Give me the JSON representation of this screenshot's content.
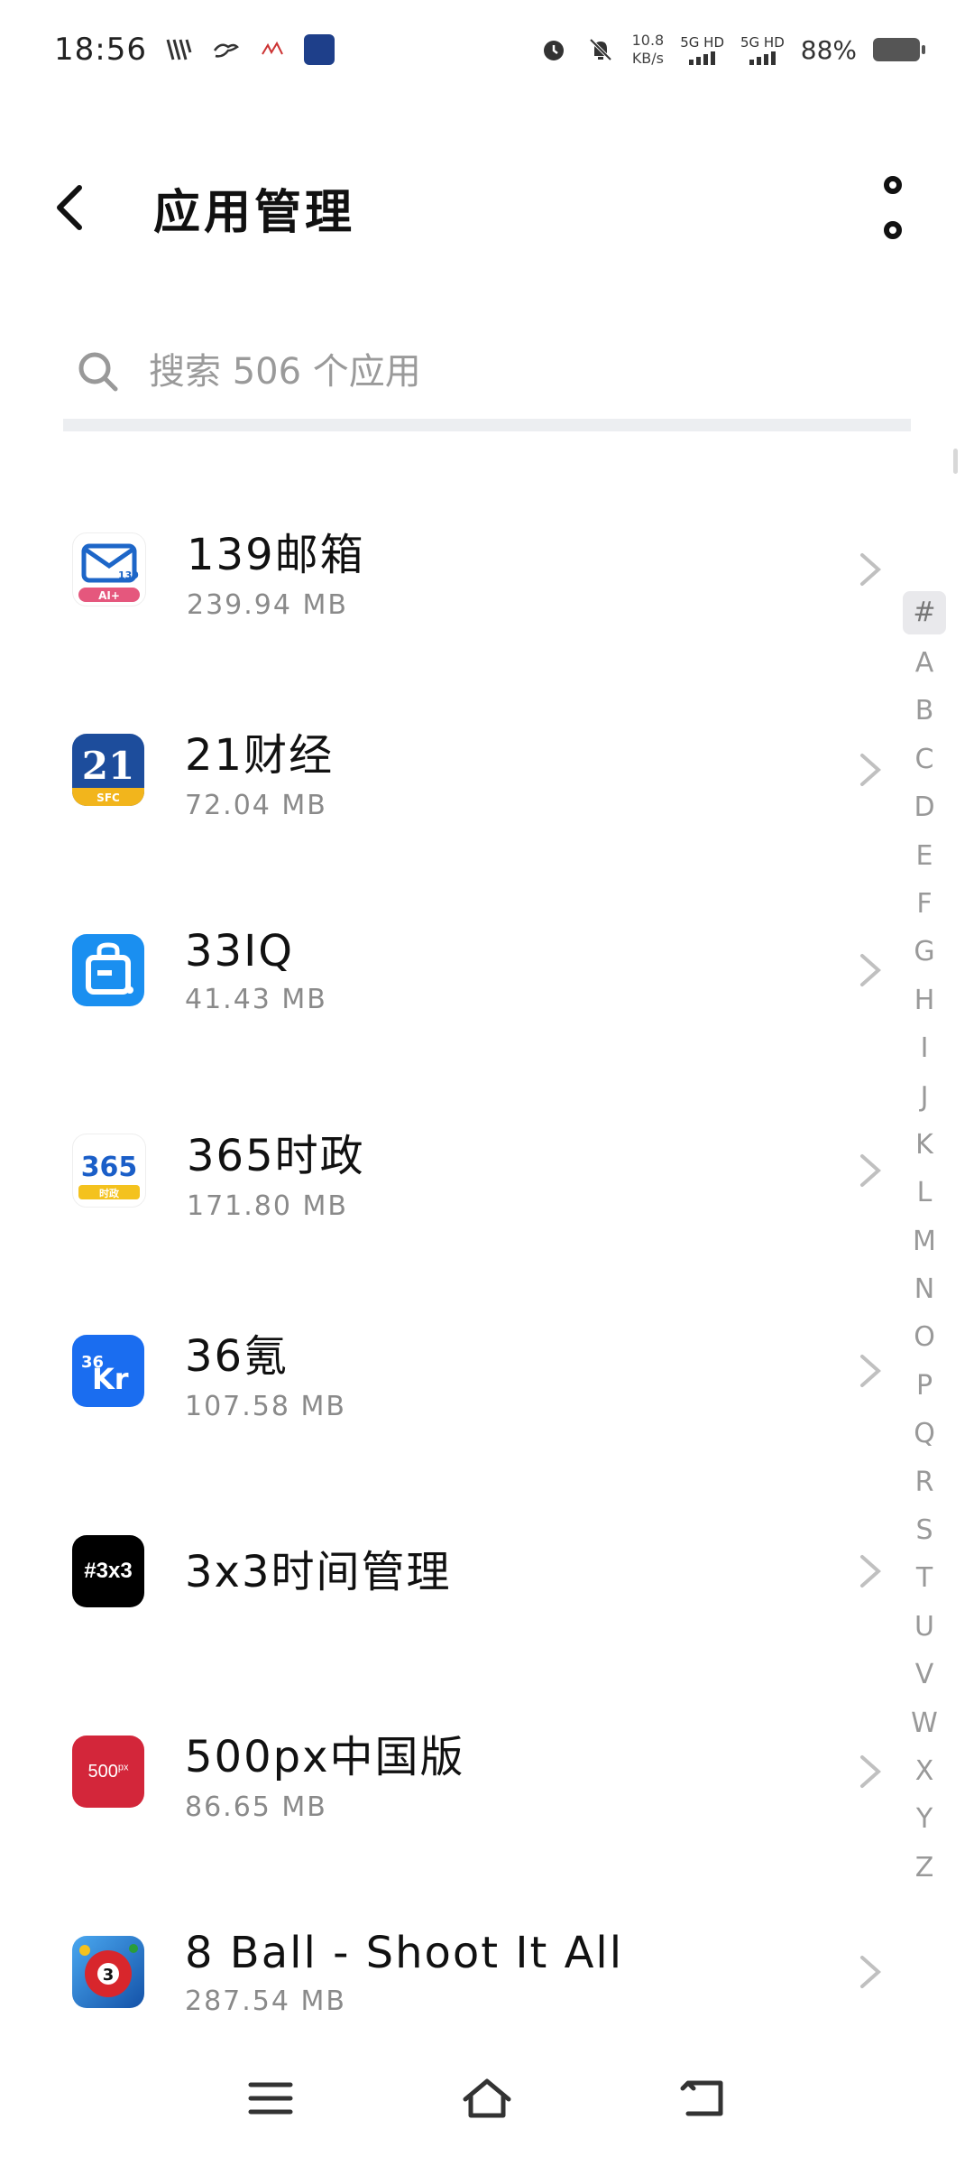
{
  "status_bar": {
    "time": "18:56",
    "network_speed_value": "10.8",
    "network_speed_unit": "KB/s",
    "signal_1": "5G HD",
    "signal_2": "5G HD",
    "battery": "88%"
  },
  "header": {
    "title": "应用管理"
  },
  "search": {
    "placeholder": "搜索 506 个应用"
  },
  "apps": [
    {
      "name": "139邮箱",
      "size": "239.94 MB",
      "icon": "mail-icon",
      "icon_color": "#ffffff"
    },
    {
      "name": "21财经",
      "size": "72.04 MB",
      "icon": "21-icon",
      "icon_color": "#1d4d9c"
    },
    {
      "name": "33IQ",
      "size": "41.43 MB",
      "icon": "bag-icon",
      "icon_color": "#1a8ff0"
    },
    {
      "name": "365时政",
      "size": "171.80 MB",
      "icon": "365-icon",
      "icon_color": "#ffffff"
    },
    {
      "name": "36氪",
      "size": "107.58 MB",
      "icon": "36kr-icon",
      "icon_color": "#1a6df0"
    },
    {
      "name": "3x3时间管理",
      "size": "",
      "icon": "3x3-icon",
      "icon_color": "#000000"
    },
    {
      "name": "500px中国版",
      "size": "86.65 MB",
      "icon": "500px-icon",
      "icon_color": "#d3263a"
    },
    {
      "name": "8 Ball - Shoot It All",
      "size": "287.54 MB",
      "icon": "8ball-icon",
      "icon_color": "#1666c4"
    }
  ],
  "icon_labels": {
    "mail_tag": "139",
    "mail_sub": "AI+",
    "ft21": "21",
    "ft21_sub": "SFC",
    "sz365": "365",
    "sz365_sub": "时政",
    "kr36_a": "36",
    "kr36_b": "Kr",
    "t3x3": "#3x3",
    "p500": "500",
    "p500_sup": "px",
    "ball8": "3"
  },
  "alphabet": [
    "#",
    "A",
    "B",
    "C",
    "D",
    "E",
    "F",
    "G",
    "H",
    "I",
    "J",
    "K",
    "L",
    "M",
    "N",
    "O",
    "P",
    "Q",
    "R",
    "S",
    "T",
    "U",
    "V",
    "W",
    "X",
    "Y",
    "Z"
  ]
}
